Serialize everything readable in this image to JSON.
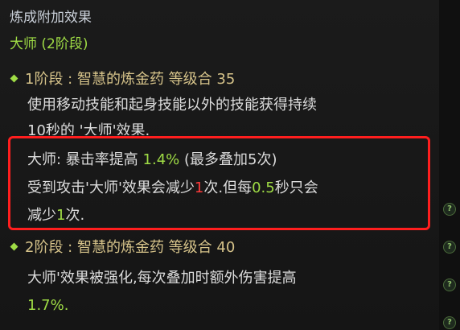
{
  "tooltip": {
    "title": "炼成附加效果",
    "subtitle": "大师 (2阶段)",
    "stage1": {
      "header": "1阶段 : 智慧的炼金药 等级合 35",
      "desc_line1": "使用移动技能和起身技能以外的技能获得持续",
      "desc_line2": "10秒的 '大师'效果.",
      "effect_line1_prefix": "大师: 暴击率提高 ",
      "effect_line1_value": "1.4%",
      "effect_line1_suffix": " (最多叠加5次)",
      "effect_line2_prefix": "受到攻击'大师'效果会减少",
      "effect_line2_count": "1",
      "effect_line2_mid": "次.但每",
      "effect_line2_interval": "0.5",
      "effect_line2_suffix": "秒只会",
      "effect_line3_prefix": "减少",
      "effect_line3_count": "1",
      "effect_line3_suffix": "次."
    },
    "stage2": {
      "header": "2阶段 : 智慧的炼金药 等级合 40",
      "desc_line1": "大师'效果被强化,每次叠加时额外伤害提高",
      "desc_line2": "1.7%."
    }
  },
  "side_icons": [
    "help-icon",
    "help-icon",
    "help-icon",
    "help-icon"
  ],
  "side_icon_glyph": "?",
  "colors": {
    "accent_green": "#9fdc45",
    "stage_gold": "#d6c38a",
    "highlight_red": "#ff1e1e",
    "number_red": "#ff3b3b"
  }
}
